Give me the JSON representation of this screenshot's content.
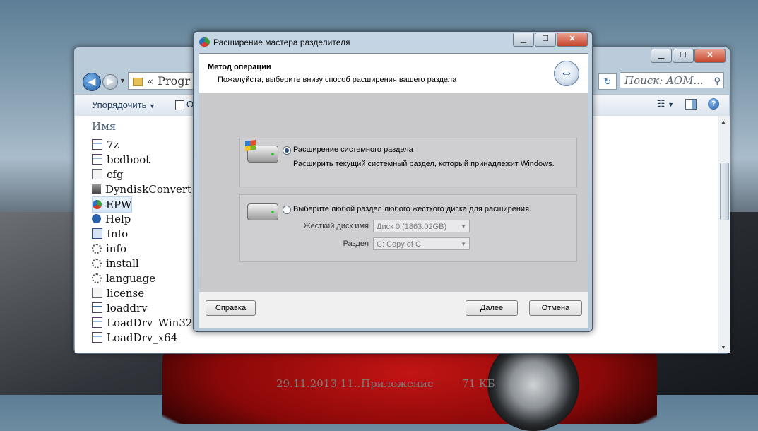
{
  "explorer": {
    "address_text": "Progr",
    "address_sep": "«",
    "search_placeholder": "Поиск: AOM...",
    "toolbar": {
      "organize_label": "Упорядочить",
      "open_label": "О"
    },
    "column_name": "Имя",
    "files": [
      {
        "name": "7z",
        "icon": "exe-icon"
      },
      {
        "name": "bcdboot",
        "icon": "exe-icon"
      },
      {
        "name": "cfg",
        "icon": "config-file-icon"
      },
      {
        "name": "DyndiskConvert",
        "icon": "disk-tool-icon"
      },
      {
        "name": "EPW",
        "icon": "epw-app-icon"
      },
      {
        "name": "Help",
        "icon": "help-file-icon"
      },
      {
        "name": "Info",
        "icon": "info-file-icon"
      },
      {
        "name": "info",
        "icon": "settings-file-icon"
      },
      {
        "name": "install",
        "icon": "settings-file-icon"
      },
      {
        "name": "language",
        "icon": "settings-file-icon"
      },
      {
        "name": "license",
        "icon": "text-file-icon"
      },
      {
        "name": "loaddrv",
        "icon": "exe-icon"
      },
      {
        "name": "LoadDrv_Win32",
        "icon": "exe-icon"
      },
      {
        "name": "LoadDrv_x64",
        "icon": "exe-icon"
      }
    ],
    "last_row_meta": {
      "date": "29.11.2013 11...",
      "type": "Приложение",
      "size": "71 КБ"
    }
  },
  "dialog": {
    "title": "Расширение мастера разделителя",
    "header_title": "Метод операции",
    "header_subtitle": "Пожалуйста, выберите внизу способ расширения вашего раздела",
    "option1": {
      "label": "Расширение системного раздела",
      "description": "Расширить текущий системный раздел, который принадлежит Windows.",
      "selected": true
    },
    "option2": {
      "label": "Выберите любой раздел любого жесткого диска для расширения.",
      "selected": false,
      "disk_label": "Жесткий диск имя",
      "disk_value": "Диск 0 (1863.02GB)",
      "partition_label": "Раздел",
      "partition_value": "C: Copy of C"
    },
    "buttons": {
      "help": "Справка",
      "next": "Далее",
      "cancel": "Отмена"
    }
  },
  "colors": {
    "accent": "#2d4f7d",
    "close_button": "#c7432b"
  }
}
